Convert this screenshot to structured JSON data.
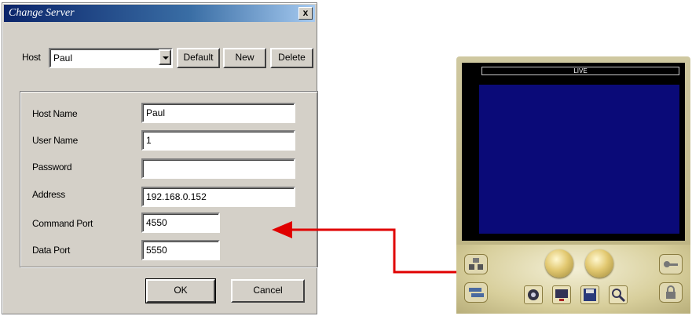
{
  "dialog": {
    "title": "Change Server",
    "host_label": "Host",
    "host_value": "Paul",
    "default_label": "Default",
    "new_label": "New",
    "delete_label": "Delete",
    "close_glyph": "x",
    "fields": [
      {
        "label": "Host Name",
        "value": "Paul"
      },
      {
        "label": "User Name",
        "value": "1"
      },
      {
        "label": "Password",
        "value": ""
      },
      {
        "label": "Address",
        "value": "192.168.0.152"
      },
      {
        "label": "Command Port",
        "value": "4550"
      },
      {
        "label": "Data Port",
        "value": "5550"
      }
    ],
    "ok_label": "OK",
    "cancel_label": "Cancel"
  },
  "viewer": {
    "live_label": "LIVE"
  },
  "colors": {
    "arrow": "#e00000",
    "screen": "#0a0a78",
    "title_bar": "#0a246a"
  },
  "icons": [
    "close-icon",
    "dropdown-arrow-icon",
    "camera-icon",
    "display-icon",
    "save-icon",
    "zoom-icon",
    "network-icon",
    "transfer-icon",
    "key-icon",
    "lock-icon"
  ]
}
